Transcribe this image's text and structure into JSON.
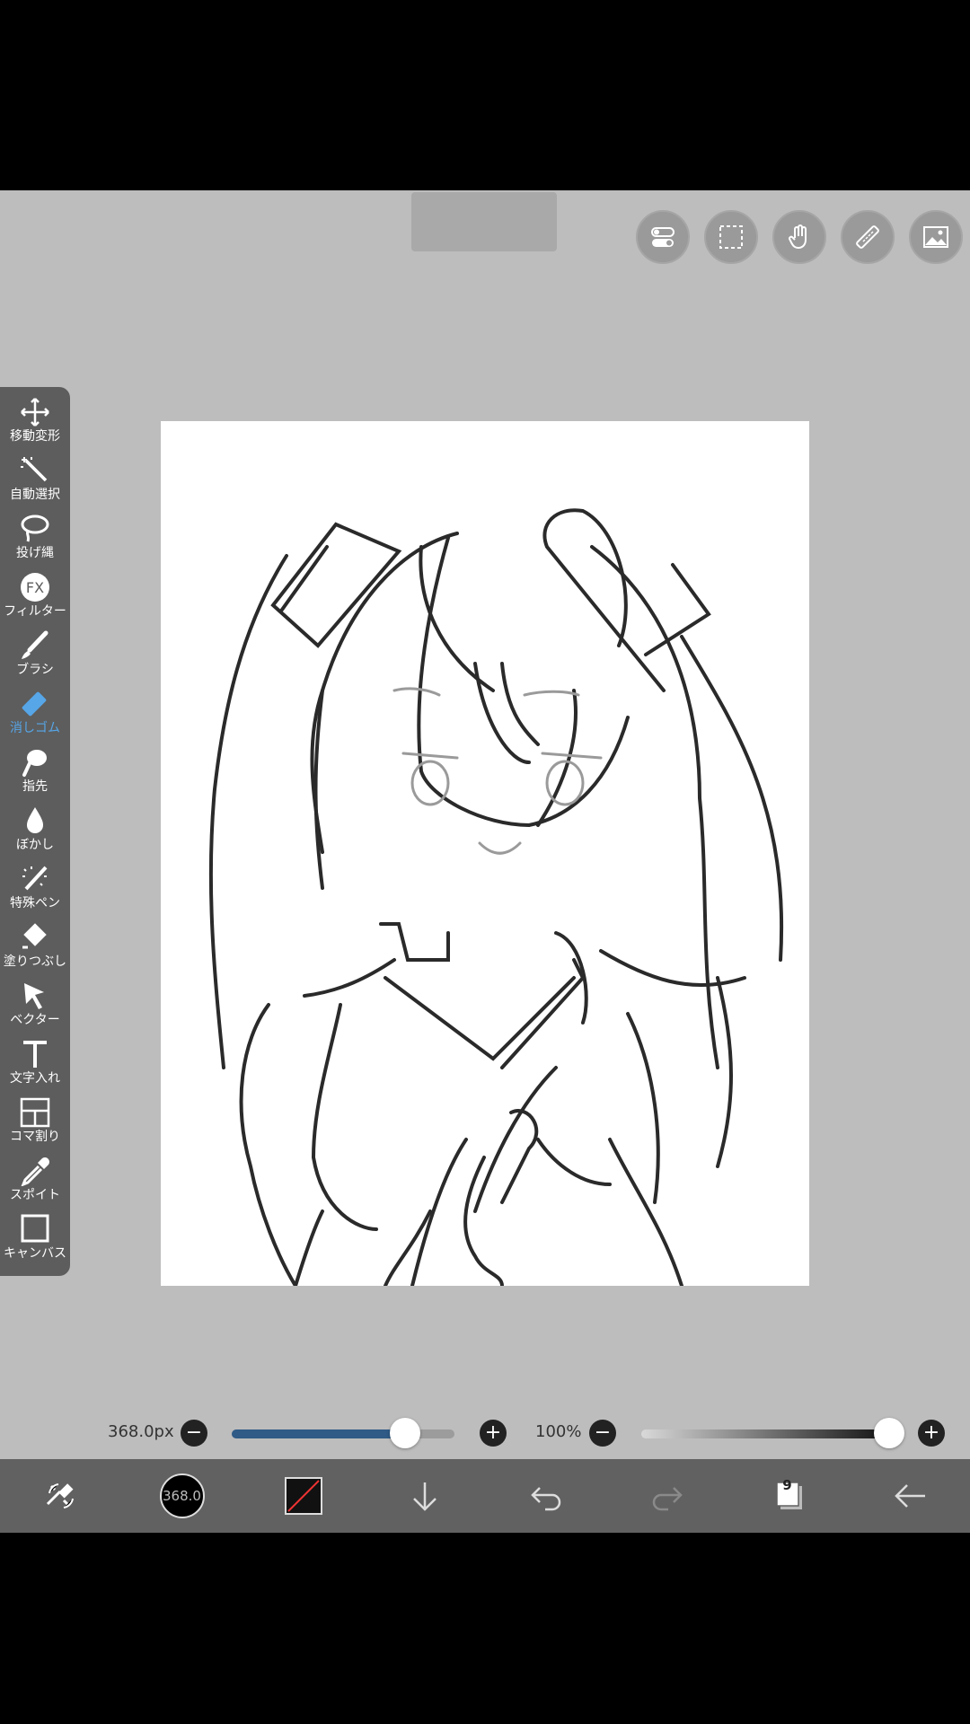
{
  "top": {
    "ghost_button_label": ""
  },
  "top_tools": [
    "toggle-icon",
    "selection-icon",
    "hand-icon",
    "ruler-icon",
    "image-icon"
  ],
  "toolbar": {
    "tools": [
      {
        "name": "transform",
        "label": "移動変形",
        "icon": "move-icon",
        "active": false
      },
      {
        "name": "magic-wand",
        "label": "自動選択",
        "icon": "magic-wand-icon",
        "active": false
      },
      {
        "name": "lasso",
        "label": "投げ縄",
        "icon": "lasso-icon",
        "active": false
      },
      {
        "name": "filter",
        "label": "フィルター",
        "icon": "fx-icon",
        "active": false
      },
      {
        "name": "brush",
        "label": "ブラシ",
        "icon": "brush-icon",
        "active": false
      },
      {
        "name": "eraser",
        "label": "消しゴム",
        "icon": "eraser-icon",
        "active": true
      },
      {
        "name": "smudge",
        "label": "指先",
        "icon": "smudge-icon",
        "active": false
      },
      {
        "name": "blur",
        "label": "ぼかし",
        "icon": "blur-icon",
        "active": false
      },
      {
        "name": "special-pen",
        "label": "特殊ペン",
        "icon": "special-pen-icon",
        "active": false
      },
      {
        "name": "fill",
        "label": "塗りつぶし",
        "icon": "fill-icon",
        "active": false
      },
      {
        "name": "vector",
        "label": "ベクター",
        "icon": "cursor-icon",
        "active": false
      },
      {
        "name": "text",
        "label": "文字入れ",
        "icon": "text-icon",
        "active": false
      },
      {
        "name": "frame-divider",
        "label": "コマ割り",
        "icon": "frame-icon",
        "active": false
      },
      {
        "name": "eyedropper",
        "label": "スポイト",
        "icon": "eyedropper-icon",
        "active": false
      },
      {
        "name": "canvas",
        "label": "キャンバス",
        "icon": "canvas-icon",
        "active": false
      }
    ]
  },
  "sliders": {
    "brush_size_label": "368.0px",
    "brush_size_fraction": 0.78,
    "opacity_label": "100%",
    "opacity_fraction": 1.0,
    "minus": "−",
    "plus": "+"
  },
  "bottombar": {
    "brush_size_value": "368.0",
    "layer_count": "9",
    "icons": [
      "swap-tools-icon",
      "brush-size-icon",
      "color-icon",
      "download-icon",
      "undo-icon",
      "redo-icon",
      "layers-icon",
      "back-icon"
    ]
  },
  "colors": {
    "accent": "#56a6e8",
    "slider_fill": "#2f5b86",
    "toolbar": "#5d5d5d",
    "bottombar": "#616161",
    "workspace": "#bdbdbd"
  }
}
